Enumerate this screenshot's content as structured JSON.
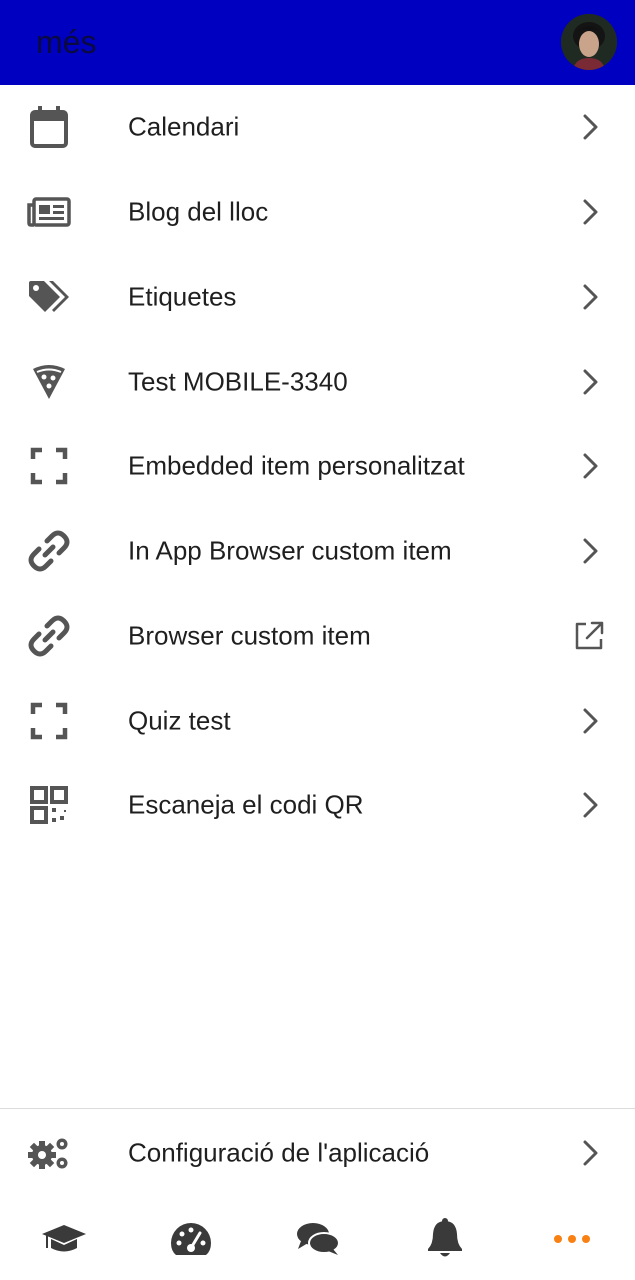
{
  "header": {
    "title": "més",
    "bg_color": "#0000c0"
  },
  "menu": {
    "items": [
      {
        "label": "Calendari",
        "icon": "calendar-icon",
        "trailing": "chevron-right-icon"
      },
      {
        "label": "Blog del lloc",
        "icon": "newspaper-icon",
        "trailing": "chevron-right-icon"
      },
      {
        "label": "Etiquetes",
        "icon": "tags-icon",
        "trailing": "chevron-right-icon"
      },
      {
        "label": "Test MOBILE-3340",
        "icon": "pizza-slice-icon",
        "trailing": "chevron-right-icon"
      },
      {
        "label": "Embedded item personalitzat",
        "icon": "expand-icon",
        "trailing": "chevron-right-icon"
      },
      {
        "label": "In App Browser custom item",
        "icon": "link-icon",
        "trailing": "chevron-right-icon"
      },
      {
        "label": "Browser custom item",
        "icon": "link-icon",
        "trailing": "external-link-icon"
      },
      {
        "label": "Quiz test",
        "icon": "expand-icon",
        "trailing": "chevron-right-icon"
      },
      {
        "label": "Escaneja el codi QR",
        "icon": "qrcode-icon",
        "trailing": "chevron-right-icon"
      }
    ]
  },
  "settings": {
    "label": "Configuració de l'aplicació",
    "icon": "cogs-icon"
  },
  "tabbar": {
    "tabs": [
      {
        "icon": "graduation-cap-icon",
        "active": false
      },
      {
        "icon": "dashboard-icon",
        "active": false
      },
      {
        "icon": "messages-icon",
        "active": false
      },
      {
        "icon": "bell-icon",
        "active": false
      },
      {
        "icon": "more-icon",
        "active": true
      }
    ],
    "active_color": "#f98012",
    "icon_color": "#3a3a3a"
  }
}
